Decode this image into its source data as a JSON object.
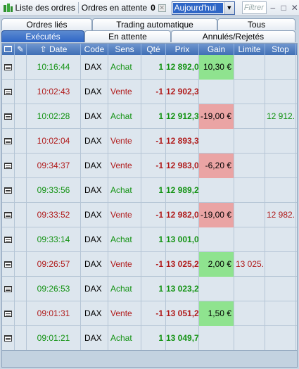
{
  "toolbar": {
    "orders_list_label": "Liste des ordres",
    "pending_label": "Ordres en attente",
    "pending_count": "0",
    "period_value": "Aujourd'hui",
    "filter_placeholder": "Filtrer",
    "minimize": "–",
    "maximize": "□",
    "close": "✕"
  },
  "tabs_row1": [
    "Ordres liés",
    "Trading automatique",
    "Tous"
  ],
  "tabs_row2": [
    "Exécutés",
    "En attente",
    "Annulés/Rejetés"
  ],
  "active_tab": "Exécutés",
  "columns": [
    "",
    "",
    "Date",
    "Code",
    "Sens",
    "Qté",
    "Prix",
    "Gain",
    "Limite",
    "Stop"
  ],
  "sort_indicator": "⇧",
  "rows": [
    {
      "time": "10:16:44",
      "code": "DAX",
      "side": "Achat",
      "qty": "1",
      "price": "12 892,0",
      "gain": "10,30 €",
      "limit": "",
      "stop": ""
    },
    {
      "time": "10:02:43",
      "code": "DAX",
      "side": "Vente",
      "qty": "-1",
      "price": "12 902,3",
      "gain": "",
      "limit": "",
      "stop": ""
    },
    {
      "time": "10:02:28",
      "code": "DAX",
      "side": "Achat",
      "qty": "1",
      "price": "12 912,3",
      "gain": "-19,00 €",
      "limit": "",
      "stop": "12 912..."
    },
    {
      "time": "10:02:04",
      "code": "DAX",
      "side": "Vente",
      "qty": "-1",
      "price": "12 893,3",
      "gain": "",
      "limit": "",
      "stop": ""
    },
    {
      "time": "09:34:37",
      "code": "DAX",
      "side": "Vente",
      "qty": "-1",
      "price": "12 983,0",
      "gain": "-6,20 €",
      "limit": "",
      "stop": ""
    },
    {
      "time": "09:33:56",
      "code": "DAX",
      "side": "Achat",
      "qty": "1",
      "price": "12 989,2",
      "gain": "",
      "limit": "",
      "stop": ""
    },
    {
      "time": "09:33:52",
      "code": "DAX",
      "side": "Vente",
      "qty": "-1",
      "price": "12 982,0",
      "gain": "-19,00 €",
      "limit": "",
      "stop": "12 982..."
    },
    {
      "time": "09:33:14",
      "code": "DAX",
      "side": "Achat",
      "qty": "1",
      "price": "13 001,0",
      "gain": "",
      "limit": "",
      "stop": ""
    },
    {
      "time": "09:26:57",
      "code": "DAX",
      "side": "Vente",
      "qty": "-1",
      "price": "13 025,2",
      "gain": "2,00 €",
      "limit": "13 025...",
      "stop": ""
    },
    {
      "time": "09:26:53",
      "code": "DAX",
      "side": "Achat",
      "qty": "1",
      "price": "13 023,2",
      "gain": "",
      "limit": "",
      "stop": ""
    },
    {
      "time": "09:01:31",
      "code": "DAX",
      "side": "Vente",
      "qty": "-1",
      "price": "13 051,2",
      "gain": "1,50 €",
      "limit": "",
      "stop": ""
    },
    {
      "time": "09:01:21",
      "code": "DAX",
      "side": "Achat",
      "qty": "1",
      "price": "13 049,7",
      "gain": "",
      "limit": "",
      "stop": ""
    }
  ],
  "colors": {
    "buy": "#139313",
    "sell": "#b01a1a",
    "gain_positive": "#8fe38f",
    "gain_negative": "#eaa4a4",
    "header": "#3f6fb5",
    "active_tab": "#2f66c6"
  }
}
